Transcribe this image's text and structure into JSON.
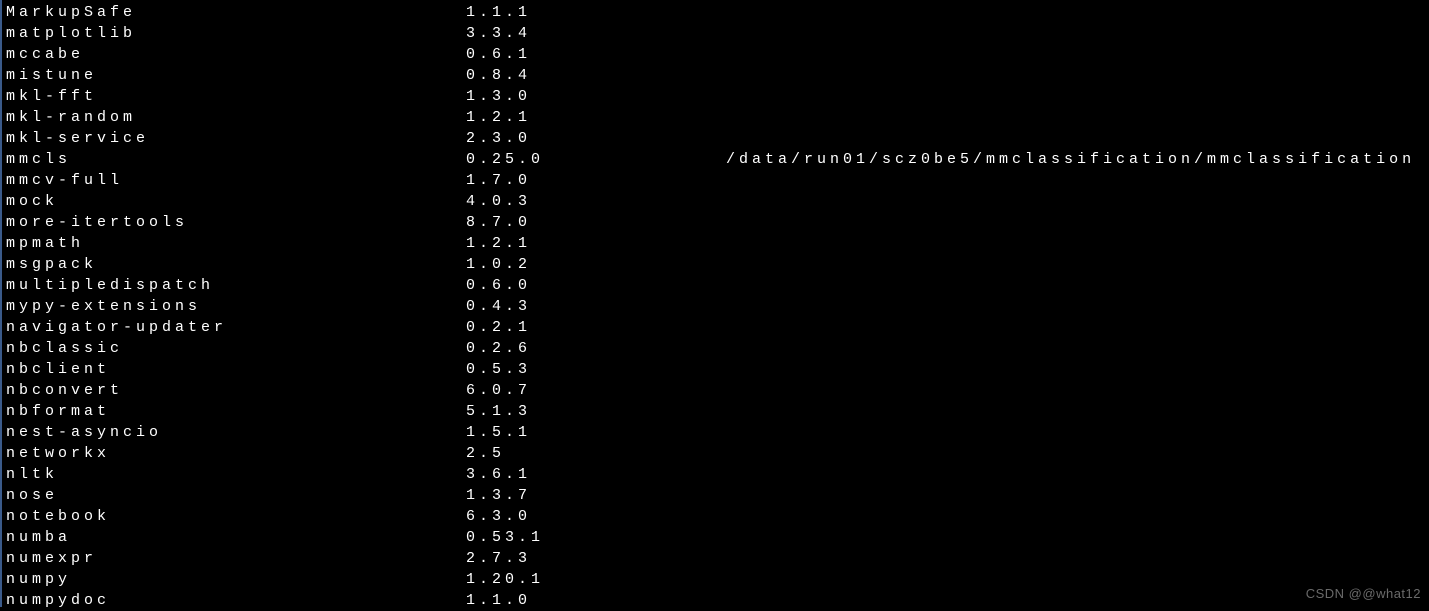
{
  "packages": [
    {
      "name": "MarkupSafe",
      "version": "1.1.1",
      "location": ""
    },
    {
      "name": "matplotlib",
      "version": "3.3.4",
      "location": ""
    },
    {
      "name": "mccabe",
      "version": "0.6.1",
      "location": ""
    },
    {
      "name": "mistune",
      "version": "0.8.4",
      "location": ""
    },
    {
      "name": "mkl-fft",
      "version": "1.3.0",
      "location": ""
    },
    {
      "name": "mkl-random",
      "version": "1.2.1",
      "location": ""
    },
    {
      "name": "mkl-service",
      "version": "2.3.0",
      "location": ""
    },
    {
      "name": "mmcls",
      "version": "0.25.0",
      "location": "/data/run01/scz0be5/mmclassification/mmclassification"
    },
    {
      "name": "mmcv-full",
      "version": "1.7.0",
      "location": ""
    },
    {
      "name": "mock",
      "version": "4.0.3",
      "location": ""
    },
    {
      "name": "more-itertools",
      "version": "8.7.0",
      "location": ""
    },
    {
      "name": "mpmath",
      "version": "1.2.1",
      "location": ""
    },
    {
      "name": "msgpack",
      "version": "1.0.2",
      "location": ""
    },
    {
      "name": "multipledispatch",
      "version": "0.6.0",
      "location": ""
    },
    {
      "name": "mypy-extensions",
      "version": "0.4.3",
      "location": ""
    },
    {
      "name": "navigator-updater",
      "version": "0.2.1",
      "location": ""
    },
    {
      "name": "nbclassic",
      "version": "0.2.6",
      "location": ""
    },
    {
      "name": "nbclient",
      "version": "0.5.3",
      "location": ""
    },
    {
      "name": "nbconvert",
      "version": "6.0.7",
      "location": ""
    },
    {
      "name": "nbformat",
      "version": "5.1.3",
      "location": ""
    },
    {
      "name": "nest-asyncio",
      "version": "1.5.1",
      "location": ""
    },
    {
      "name": "networkx",
      "version": "2.5",
      "location": ""
    },
    {
      "name": "nltk",
      "version": "3.6.1",
      "location": ""
    },
    {
      "name": "nose",
      "version": "1.3.7",
      "location": ""
    },
    {
      "name": "notebook",
      "version": "6.3.0",
      "location": ""
    },
    {
      "name": "numba",
      "version": "0.53.1",
      "location": ""
    },
    {
      "name": "numexpr",
      "version": "2.7.3",
      "location": ""
    },
    {
      "name": "numpy",
      "version": "1.20.1",
      "location": ""
    },
    {
      "name": "numpydoc",
      "version": "1.1.0",
      "location": ""
    }
  ],
  "watermark": "CSDN @@what12"
}
